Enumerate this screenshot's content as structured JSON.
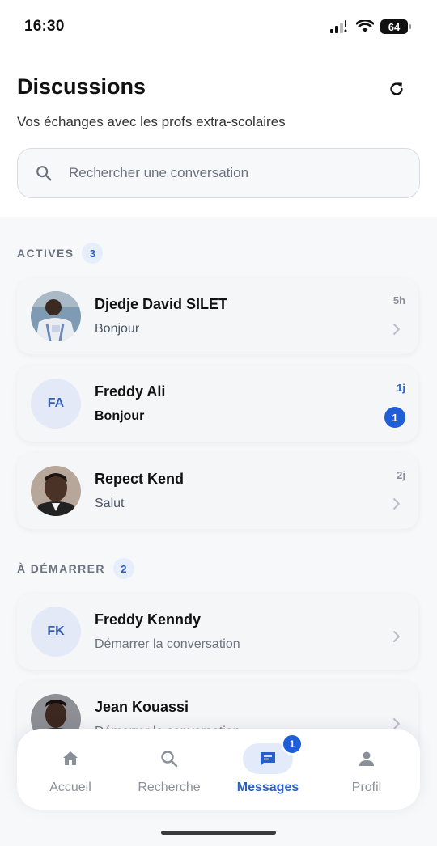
{
  "status_bar": {
    "time": "16:30",
    "battery": "64"
  },
  "header": {
    "title": "Discussions",
    "subtitle": "Vos échanges avec les profs extra-scolaires",
    "refresh_icon": "refresh-icon"
  },
  "search": {
    "placeholder": "Rechercher une conversation",
    "icon": "search-icon"
  },
  "sections": {
    "active": {
      "title": "ACTIVES",
      "count": "3",
      "items": [
        {
          "name": "Djedje David SILET",
          "message": "Bonjour",
          "time": "5h",
          "avatar": "photo",
          "unread": false
        },
        {
          "name": "Freddy Ali",
          "message": "Bonjour",
          "time": "1j",
          "avatar_initials": "FA",
          "unread": true,
          "unread_count": "1"
        },
        {
          "name": "Repect Kend",
          "message": "Salut",
          "time": "2j",
          "avatar": "photo",
          "unread": false
        }
      ]
    },
    "to_start": {
      "title": "À DÉMARRER",
      "count": "2",
      "items": [
        {
          "name": "Freddy Kenndy",
          "message": "Démarrer la conversation",
          "avatar_initials": "FK"
        },
        {
          "name": "Jean Kouassi",
          "message": "Démarrer la conversation",
          "avatar": "photo"
        }
      ]
    }
  },
  "bottom_nav": {
    "items": [
      {
        "label": "Accueil",
        "icon": "home-icon"
      },
      {
        "label": "Recherche",
        "icon": "search-icon"
      },
      {
        "label": "Messages",
        "icon": "chat-icon",
        "badge": "1",
        "active": true
      },
      {
        "label": "Profil",
        "icon": "person-icon"
      }
    ]
  },
  "colors": {
    "accent": "#1f5ed6",
    "badge_bg": "#e6eefb"
  }
}
